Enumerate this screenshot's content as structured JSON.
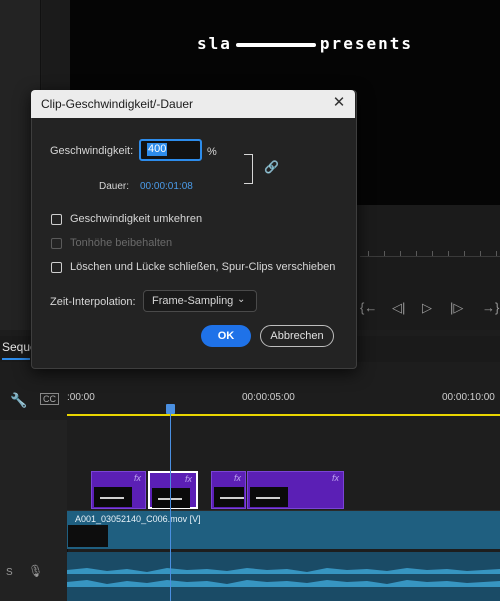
{
  "program_monitor": {
    "title_left": "sla",
    "title_right": "presents",
    "transport": [
      "{←",
      "◁|",
      "▷",
      "|▷",
      "→}",
      "⇥"
    ]
  },
  "tabs": {
    "sequence": "Seque"
  },
  "timeline": {
    "timecodes": [
      ":00:00",
      "00:00:05:00",
      "00:00:10:00"
    ],
    "v1_clip_label": "A001_03052140_C006.mov [V]",
    "audio_track_label": "S",
    "nest_clip_fx": "fx",
    "colors": {
      "nest_clip": "#5b1fb5",
      "video_track": "#1f5f80",
      "audio_track": "#1a4b66",
      "work_area": "#e8d400",
      "playhead": "#4a8fe0"
    }
  },
  "dialog": {
    "title": "Clip-Geschwindigkeit/-Dauer",
    "speed_label": "Geschwindigkeit:",
    "speed_value": "400",
    "speed_unit": "%",
    "duration_label": "Dauer:",
    "duration_value": "00:00:01:08",
    "checkboxes": [
      {
        "label": "Geschwindigkeit umkehren",
        "checked": false,
        "disabled": false
      },
      {
        "label": "Tonhöhe beibehalten",
        "checked": false,
        "disabled": true
      },
      {
        "label": "Löschen und Lücke schließen, Spur-Clips verschieben",
        "checked": false,
        "disabled": false
      }
    ],
    "interp_label": "Zeit-Interpolation:",
    "interp_value": "Frame-Sampling",
    "ok_label": "OK",
    "cancel_label": "Abbrechen",
    "accent_color": "#1f72e8"
  }
}
